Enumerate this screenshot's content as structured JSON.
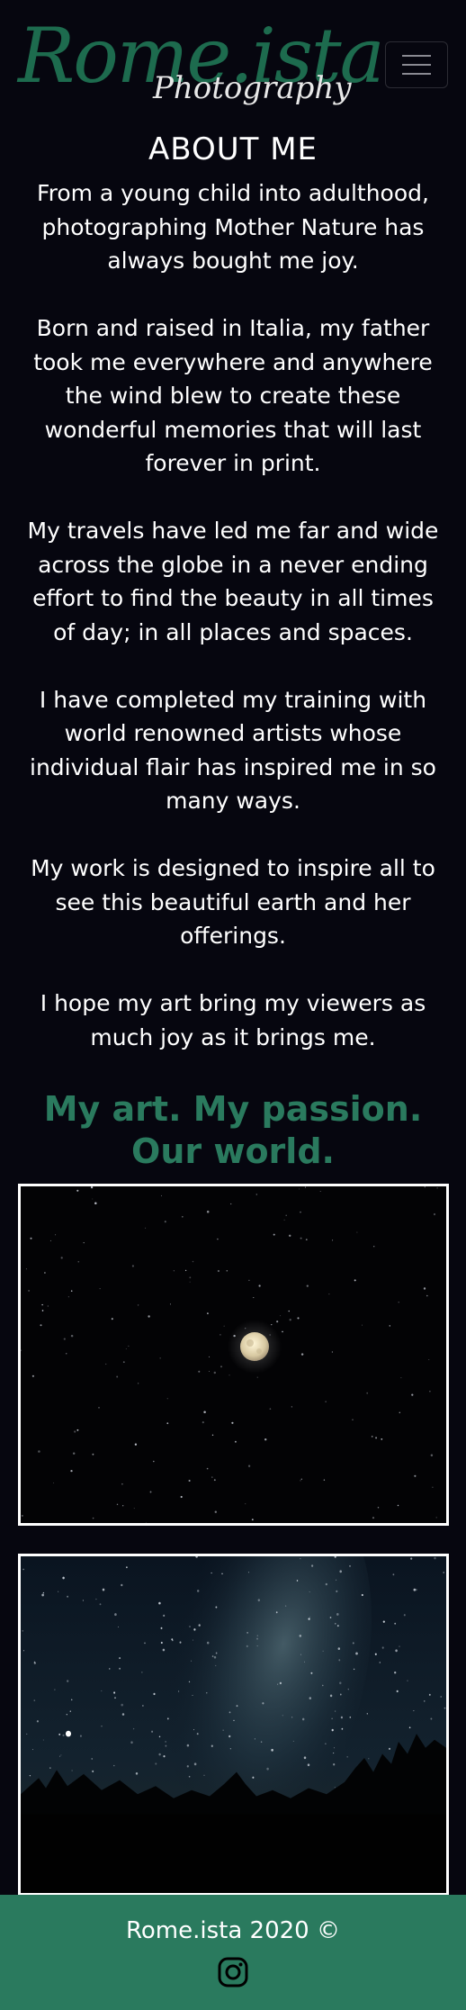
{
  "brand": {
    "name_main": "Rome.ista",
    "name_sub": "Photography"
  },
  "nav": {
    "toggle_icon": "hamburger-icon"
  },
  "about": {
    "heading": "ABOUT ME",
    "paragraphs": [
      "From a young child into adulthood, photographing Mother Nature has always bought me joy.",
      "Born and raised in Italia, my father took me everywhere and anywhere the wind blew to create these wonderful memories that will last forever in print.",
      "My travels have led me far and wide across the globe in a never ending effort to find the beauty in all times of day; in all places and spaces.",
      "I have completed my training with world renowned artists whose individual flair has inspired me in so many ways.",
      "My work is designed to inspire all to see this beautiful earth and her offerings.",
      "I hope my art bring my viewers as much joy as it brings me."
    ]
  },
  "tagline": "My art. My passion. Our world.",
  "gallery": {
    "photos": [
      {
        "subject": "full moon in starry night sky"
      },
      {
        "subject": "milky way over silhouetted tree line"
      }
    ]
  },
  "footer": {
    "copyright": "Rome.ista 2020 ©",
    "social_icon": "instagram-icon"
  },
  "colors": {
    "background": "#06060f",
    "accent": "#2a7a5e",
    "logo": "#1d6b4e",
    "text": "#ffffff"
  }
}
